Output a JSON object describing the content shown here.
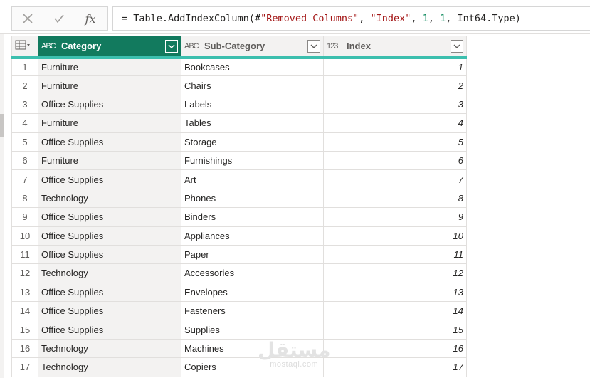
{
  "formula_bar": {
    "cancel_icon": "x-icon",
    "commit_icon": "check-icon",
    "fx_label": "fx",
    "formula_parts": {
      "prefix": "= Table.AddIndexColumn(#",
      "s1": "\"Removed Columns\"",
      "c1": ", ",
      "s2": "\"Index\"",
      "c2": ", ",
      "n1": "1",
      "c3": ", ",
      "n2": "1",
      "suffix": ", Int64.Type)"
    }
  },
  "grid": {
    "columns": [
      {
        "type_icon": "ABC",
        "label": "Category"
      },
      {
        "type_icon": "ABC",
        "label": "Sub-Category"
      },
      {
        "type_icon": "123",
        "label": "Index"
      }
    ],
    "rows": [
      {
        "n": "1",
        "category": "Furniture",
        "sub": "Bookcases",
        "index": "1"
      },
      {
        "n": "2",
        "category": "Furniture",
        "sub": "Chairs",
        "index": "2"
      },
      {
        "n": "3",
        "category": "Office Supplies",
        "sub": "Labels",
        "index": "3"
      },
      {
        "n": "4",
        "category": "Furniture",
        "sub": "Tables",
        "index": "4"
      },
      {
        "n": "5",
        "category": "Office Supplies",
        "sub": "Storage",
        "index": "5"
      },
      {
        "n": "6",
        "category": "Furniture",
        "sub": "Furnishings",
        "index": "6"
      },
      {
        "n": "7",
        "category": "Office Supplies",
        "sub": "Art",
        "index": "7"
      },
      {
        "n": "8",
        "category": "Technology",
        "sub": "Phones",
        "index": "8"
      },
      {
        "n": "9",
        "category": "Office Supplies",
        "sub": "Binders",
        "index": "9"
      },
      {
        "n": "10",
        "category": "Office Supplies",
        "sub": "Appliances",
        "index": "10"
      },
      {
        "n": "11",
        "category": "Office Supplies",
        "sub": "Paper",
        "index": "11"
      },
      {
        "n": "12",
        "category": "Technology",
        "sub": "Accessories",
        "index": "12"
      },
      {
        "n": "13",
        "category": "Office Supplies",
        "sub": "Envelopes",
        "index": "13"
      },
      {
        "n": "14",
        "category": "Office Supplies",
        "sub": "Fasteners",
        "index": "14"
      },
      {
        "n": "15",
        "category": "Office Supplies",
        "sub": "Supplies",
        "index": "15"
      },
      {
        "n": "16",
        "category": "Technology",
        "sub": "Machines",
        "index": "16"
      },
      {
        "n": "17",
        "category": "Technology",
        "sub": "Copiers",
        "index": "17"
      }
    ]
  },
  "colors": {
    "selected_header": "#127a5e",
    "header_accent": "#3cbfae",
    "string": "#a31515",
    "number": "#09885a"
  },
  "watermark": {
    "arabic": "مستقل",
    "latin": "mostaql.com"
  }
}
